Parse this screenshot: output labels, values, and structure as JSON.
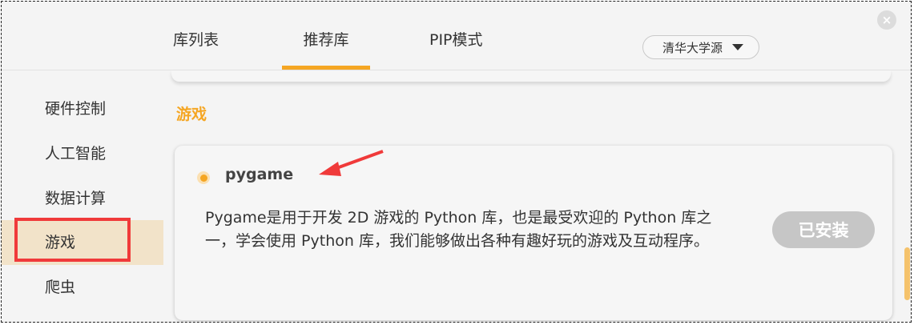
{
  "tabs": [
    {
      "label": "库列表",
      "active": false
    },
    {
      "label": "推荐库",
      "active": true
    },
    {
      "label": "PIP模式",
      "active": false
    }
  ],
  "source_select": {
    "label": "清华大学源"
  },
  "close_button": {
    "label": "×"
  },
  "sidebar": {
    "items": [
      {
        "label": "硬件控制",
        "active": false
      },
      {
        "label": "人工智能",
        "active": false
      },
      {
        "label": "数据计算",
        "active": false
      },
      {
        "label": "游戏",
        "active": true
      },
      {
        "label": "爬虫",
        "active": false
      }
    ]
  },
  "section": {
    "title": "游戏"
  },
  "library": {
    "name": "pygame",
    "description": "Pygame是用于开发 2D 游戏的 Python 库，也是最受欢迎的 Python 库之一，学会使用 Python 库，我们能够做出各种有趣好玩的游戏及互动程序。",
    "button_label": "已安装"
  },
  "colors": {
    "accent": "#f5a623",
    "annotation_red": "#f03a3a",
    "active_sidebar_bg": "#f2e3c9",
    "installed_button_bg": "#c6c6c6"
  },
  "icons": {
    "close": "close-icon",
    "dropdown": "chevron-down-icon",
    "radio": "radio-selected-icon"
  }
}
